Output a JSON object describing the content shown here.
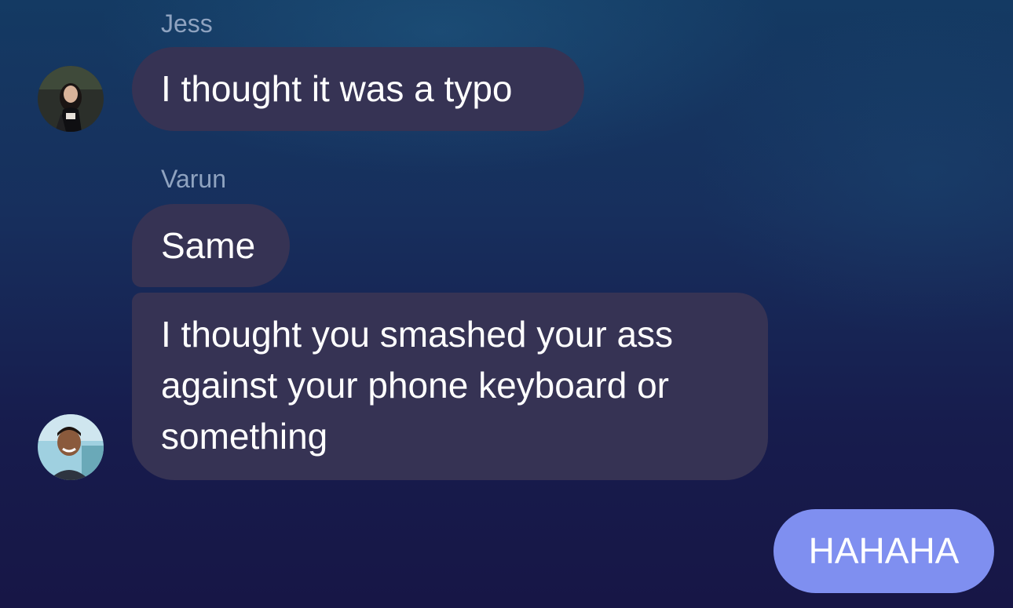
{
  "colors": {
    "incoming_bubble": "#363354",
    "outgoing_bubble": "#7f8ff0",
    "sender_name": "#8fa3c0",
    "text": "#ffffff"
  },
  "messages": [
    {
      "sender": "Jess",
      "avatar": "jess-avatar-photo",
      "bubbles": [
        "I thought it was a typo"
      ]
    },
    {
      "sender": "Varun",
      "avatar": "varun-avatar-photo",
      "bubbles": [
        "Same",
        "I thought you smashed your ass\nagainst your phone keyboard or\nsomething"
      ]
    }
  ],
  "outgoing": {
    "text": "HAHAHA"
  }
}
